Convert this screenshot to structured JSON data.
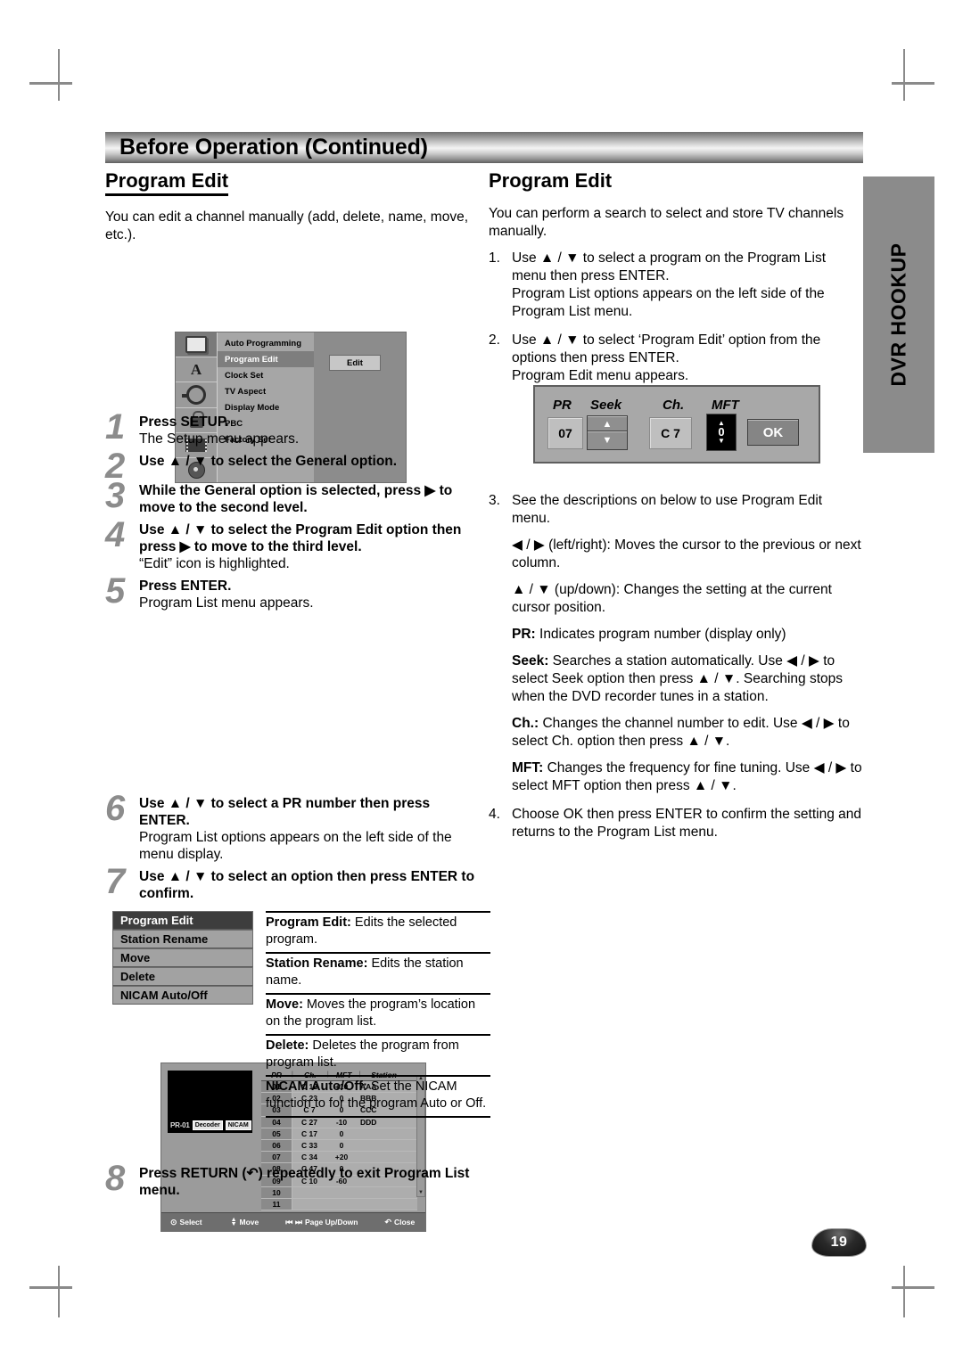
{
  "header": {
    "title": "Before Operation (Continued)"
  },
  "side_tab": {
    "label": "DVR HOOKUP"
  },
  "page_number": "19",
  "left_column": {
    "section_title": "Program Edit",
    "intro": "You can edit a channel manually (add, delete, name, move, etc.).",
    "setup_menu": {
      "icons": [
        "tv-icon",
        "language-icon",
        "audio-icon",
        "lock-icon",
        "film-icon",
        "disc-icon"
      ],
      "items": [
        "Auto Programming",
        "Program Edit",
        "Clock Set",
        "TV Aspect",
        "Display Mode",
        "PBC",
        "Factory Set"
      ],
      "selected_item": "Program Edit",
      "edit_button": "Edit"
    },
    "steps": [
      {
        "num": "1",
        "lead": "Press SETUP.",
        "sub": "The Setup menu appears."
      },
      {
        "num": "2",
        "lead": "Use ▲ / ▼ to select the General option.",
        "sub": ""
      },
      {
        "num": "3",
        "lead": "While the General option is selected, press ▶ to move to the second level.",
        "sub": ""
      },
      {
        "num": "4",
        "lead": "Use ▲ / ▼ to select the Program Edit option then press ▶ to move to the third level.",
        "sub": "“Edit” icon is highlighted."
      },
      {
        "num": "5",
        "lead": "Press ENTER.",
        "sub": "Program List menu appears."
      },
      {
        "num": "6",
        "lead": "Use ▲ / ▼ to select a PR number then press ENTER.",
        "sub": "Program List options appears on the left side of the menu display."
      },
      {
        "num": "7",
        "lead": "Use ▲ / ▼ to select an option then press ENTER to confirm.",
        "sub": ""
      },
      {
        "num": "8",
        "lead": "Press RETURN (ὸ↵) repeatedly to exit Program List menu.",
        "sub": ""
      }
    ],
    "step8_label_pre": "Press RETURN (",
    "step8_label_post": ") repeatedly to exit Program List menu.",
    "program_list": {
      "preview": {
        "pr": "PR-01",
        "chips": [
          "Decoder",
          "NICAM"
        ]
      },
      "columns": [
        "PR",
        "Ch.",
        "MFT",
        "Station"
      ],
      "rows": [
        {
          "pr": "01",
          "ch": "C 12",
          "mft": "+10",
          "station": "AAA"
        },
        {
          "pr": "02",
          "ch": "C 23",
          "mft": "0",
          "station": "BBB"
        },
        {
          "pr": "03",
          "ch": "C 7",
          "mft": "0",
          "station": "CCC"
        },
        {
          "pr": "04",
          "ch": "C 27",
          "mft": "-10",
          "station": "DDD"
        },
        {
          "pr": "05",
          "ch": "C 17",
          "mft": "0",
          "station": ""
        },
        {
          "pr": "06",
          "ch": "C 33",
          "mft": "0",
          "station": ""
        },
        {
          "pr": "07",
          "ch": "C 34",
          "mft": "+20",
          "station": ""
        },
        {
          "pr": "08",
          "ch": "C 47",
          "mft": "0",
          "station": ""
        },
        {
          "pr": "09",
          "ch": "C 10",
          "mft": "-60",
          "station": ""
        },
        {
          "pr": "10",
          "ch": "",
          "mft": "",
          "station": ""
        },
        {
          "pr": "11",
          "ch": "",
          "mft": "",
          "station": ""
        }
      ],
      "footer": [
        {
          "icon": "select-icon",
          "glyph": "⊙",
          "label": "Select"
        },
        {
          "icon": "updown-icon",
          "glyph": "",
          "label": "Move"
        },
        {
          "icon": "skip-icon",
          "glyph": "⏮ ⏭",
          "label": "Page Up/Down"
        },
        {
          "icon": "return-icon",
          "glyph": "↶",
          "label": "Close"
        }
      ]
    },
    "options": {
      "items": [
        "Program Edit",
        "Station Rename",
        "Move",
        "Delete",
        "NICAM Auto/Off"
      ],
      "selected": "Program Edit",
      "descriptions": [
        {
          "term": "Program Edit:",
          "text": " Edits the selected program."
        },
        {
          "term": "Station Rename:",
          "text": " Edits the station name."
        },
        {
          "term": "Move:",
          "text": " Moves the program’s location on the program list."
        },
        {
          "term": "Delete:",
          "text": " Deletes the program from program list."
        },
        {
          "term": "NICAM Auto/Off:",
          "text": " Set the NICAM function to for the program Auto or Off."
        }
      ]
    }
  },
  "right_column": {
    "section_title": "Program Edit",
    "intro": "You can perform a search to select and store TV channels manually.",
    "steps": [
      {
        "num": "1.",
        "lines": [
          "Use ▲ / ▼ to select a program on the Program List menu then press ENTER.",
          "Program List options appears on the left side of the Program List menu."
        ]
      },
      {
        "num": "2.",
        "lines": [
          "Use ▲ / ▼ to select ‘Program Edit’ option from the options then press ENTER.",
          "Program Edit menu appears."
        ]
      }
    ],
    "edit_panel": {
      "labels": {
        "pr": "PR",
        "seek": "Seek",
        "ch": "Ch.",
        "mft": "MFT"
      },
      "pr_value": "07",
      "ch_value": "C 7",
      "mft_value": "0",
      "ok_label": "OK"
    },
    "step3": {
      "num": "3.",
      "intro": "See the descriptions on below to use Program Edit menu.",
      "descriptions": [
        {
          "term": "◀ / ▶ (left/right):",
          "text": " Moves the cursor to the previous or next column.",
          "bold_term": false
        },
        {
          "term": "▲ / ▼ (up/down):",
          "text": " Changes the setting at the current cursor position.",
          "bold_term": false
        },
        {
          "term": "PR:",
          "text": " Indicates program number (display only)",
          "bold_term": true
        },
        {
          "term": "Seek:",
          "text": " Searches a station automatically. Use ◀ / ▶ to select Seek option then press ▲ / ▼. Searching stops when the DVD recorder tunes in a station.",
          "bold_term": true
        },
        {
          "term": "Ch.:",
          "text": " Changes the channel number to edit. Use ◀ / ▶ to select Ch. option then press ▲ / ▼.",
          "bold_term": true
        },
        {
          "term": "MFT:",
          "text": " Changes the frequency for fine tuning. Use ◀ / ▶ to select MFT option then press ▲ / ▼.",
          "bold_term": true
        }
      ]
    },
    "step4": {
      "num": "4.",
      "text": "Choose OK then press ENTER to confirm the setting and returns to the Program List menu."
    }
  }
}
